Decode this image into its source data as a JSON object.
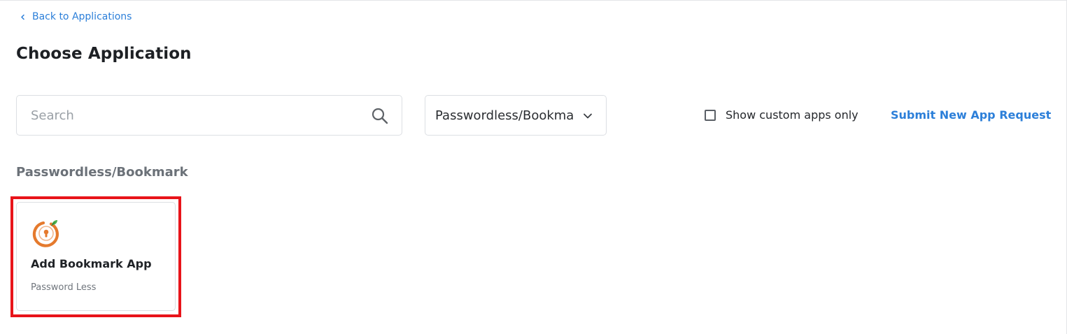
{
  "nav": {
    "back_label": "Back to Applications"
  },
  "page": {
    "title": "Choose Application"
  },
  "filters": {
    "search_placeholder": "Search",
    "search_value": "",
    "category_selected": "Passwordless/Bookmark",
    "custom_apps_label": "Show custom apps only",
    "custom_apps_checked": false,
    "submit_request_label": "Submit New App Request"
  },
  "section": {
    "heading": "Passwordless/Bookmark",
    "apps": [
      {
        "name": "Add Bookmark App",
        "type": "Password Less",
        "icon": "bookmark-app-logo-icon"
      }
    ]
  },
  "colors": {
    "link": "#2c7fd9",
    "highlight": "#e8141a",
    "logo_orange": "#e57a2d",
    "logo_leaf": "#4caf50"
  }
}
